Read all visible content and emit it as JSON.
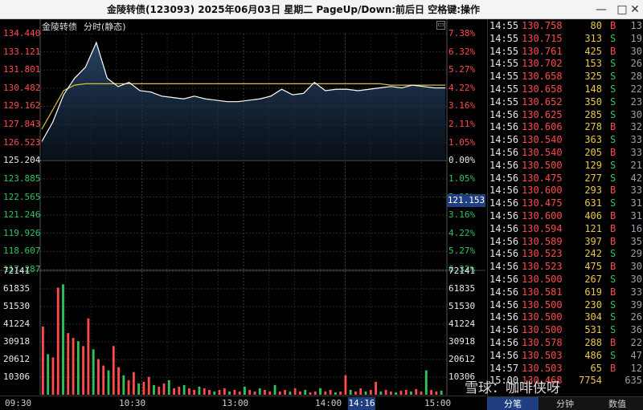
{
  "window": {
    "title": "金陵转债(123093) 2025年06月03日 星期二 PageUp/Down:前后日 空格键:操作",
    "buttons": [
      "minimize-icon",
      "close-icon"
    ]
  },
  "chart": {
    "name": "金陵转债",
    "mode": "分时(静态)",
    "checkbox": "▭",
    "prices_up": [
      "134.440",
      "133.121",
      "131.801",
      "130.482",
      "129.162",
      "127.843",
      "126.523"
    ],
    "price_base": "125.204",
    "prices_down": [
      "123.885",
      "122.565",
      "121.246",
      "119.926",
      "118.607",
      "117.287"
    ],
    "pct_up": [
      "7.38%",
      "6.32%",
      "5.27%",
      "4.22%",
      "3.16%",
      "2.11%",
      "1.05%"
    ],
    "pct_base": "0.00%",
    "pct_down": [
      "1.05%",
      "2.11%",
      "3.16%",
      "4.22%",
      "5.27%",
      "6.32%"
    ],
    "volume_labels": [
      "72141",
      "61835",
      "51530",
      "41224",
      "30918",
      "20612",
      "10306"
    ],
    "x_labels": [
      "09:30",
      "10:30",
      "13:00",
      "14:00",
      "15:00"
    ],
    "cursor_time": "14:16",
    "cursor_price": "121.153",
    "colors": {
      "up": "#ff4b4b",
      "down": "#2ec45c",
      "price_line": "#ffffff",
      "avg_line": "#d8c040",
      "cursor_bg": "#1f3f80"
    }
  },
  "chart_data": {
    "type": "line",
    "x": [
      "09:30",
      "10:30",
      "13:00",
      "14:00",
      "15:00"
    ],
    "ylim": [
      117.287,
      134.44
    ],
    "base_price": 125.204,
    "series": [
      {
        "name": "price",
        "values": [
          126.6,
          128.0,
          130.0,
          131.2,
          132.0,
          133.8,
          131.2,
          130.6,
          130.9,
          130.3,
          130.2,
          129.9,
          129.8,
          129.7,
          129.9,
          129.7,
          129.6,
          129.5,
          129.5,
          129.6,
          129.7,
          129.9,
          130.4,
          130.0,
          130.1,
          130.9,
          130.3,
          130.4,
          130.4,
          130.3,
          130.4,
          130.5,
          130.6,
          130.5,
          130.7,
          130.6,
          130.5,
          130.5
        ]
      },
      {
        "name": "avg",
        "values": [
          127.5,
          128.9,
          130.3,
          130.7,
          130.8,
          130.8,
          130.8,
          130.8,
          130.8,
          130.8,
          130.8,
          130.8,
          130.8,
          130.8,
          130.8,
          130.8,
          130.8,
          130.8,
          130.8,
          130.8,
          130.8,
          130.8,
          130.8,
          130.8,
          130.8,
          130.8,
          130.8,
          130.8,
          130.8,
          130.8,
          130.8,
          130.8,
          130.7,
          130.7,
          130.7,
          130.7,
          130.7,
          130.7
        ]
      }
    ],
    "volume_ylim": [
      0,
      72141
    ],
    "volume": [
      42000,
      25000,
      23000,
      66000,
      68000,
      38000,
      35000,
      33000,
      30000,
      47000,
      28000,
      22000,
      18000,
      15000,
      30000,
      17000,
      12000,
      9000,
      14000,
      7000,
      8000,
      11000,
      6000,
      5000,
      7000,
      9000,
      4000,
      5000,
      6000,
      4000,
      3000,
      5000,
      4000,
      3000,
      2000,
      3000,
      4000,
      2000,
      3000,
      2000,
      5000,
      3000,
      2000,
      4000,
      3000,
      2000,
      6000,
      2000,
      3000,
      2000,
      4000,
      2000,
      3000,
      1500,
      2000,
      4000,
      2000,
      3000,
      1500,
      2000,
      12000,
      3000,
      2000,
      4000,
      2000,
      3000,
      8000,
      2000,
      3000,
      2000,
      1500,
      2500,
      3000,
      2000,
      3500,
      2000,
      15000,
      3000,
      2000,
      2500
    ]
  },
  "trades": [
    {
      "time": "14:55",
      "price": "130.758",
      "vol": "80",
      "side": "B",
      "count": "13"
    },
    {
      "time": "14:55",
      "price": "130.715",
      "vol": "313",
      "side": "S",
      "count": "19"
    },
    {
      "time": "14:55",
      "price": "130.761",
      "vol": "425",
      "side": "B",
      "count": "30"
    },
    {
      "time": "14:55",
      "price": "130.702",
      "vol": "153",
      "side": "S",
      "count": "26"
    },
    {
      "time": "14:55",
      "price": "130.658",
      "vol": "325",
      "side": "S",
      "count": "28"
    },
    {
      "time": "14:55",
      "price": "130.658",
      "vol": "148",
      "side": "S",
      "count": "22"
    },
    {
      "time": "14:55",
      "price": "130.652",
      "vol": "350",
      "side": "S",
      "count": "23"
    },
    {
      "time": "14:56",
      "price": "130.625",
      "vol": "285",
      "side": "S",
      "count": "30"
    },
    {
      "time": "14:56",
      "price": "130.606",
      "vol": "278",
      "side": "B",
      "count": "32"
    },
    {
      "time": "14:56",
      "price": "130.540",
      "vol": "363",
      "side": "S",
      "count": "33"
    },
    {
      "time": "14:56",
      "price": "130.540",
      "vol": "205",
      "side": "B",
      "count": "33"
    },
    {
      "time": "14:56",
      "price": "130.500",
      "vol": "129",
      "side": "S",
      "count": "21"
    },
    {
      "time": "14:56",
      "price": "130.475",
      "vol": "277",
      "side": "S",
      "count": "42"
    },
    {
      "time": "14:56",
      "price": "130.600",
      "vol": "293",
      "side": "B",
      "count": "33"
    },
    {
      "time": "14:56",
      "price": "130.475",
      "vol": "631",
      "side": "S",
      "count": "31"
    },
    {
      "time": "14:56",
      "price": "130.600",
      "vol": "406",
      "side": "B",
      "count": "31"
    },
    {
      "time": "14:56",
      "price": "130.594",
      "vol": "121",
      "side": "B",
      "count": "16"
    },
    {
      "time": "14:56",
      "price": "130.589",
      "vol": "397",
      "side": "B",
      "count": "35"
    },
    {
      "time": "14:56",
      "price": "130.523",
      "vol": "242",
      "side": "S",
      "count": "29"
    },
    {
      "time": "14:56",
      "price": "130.523",
      "vol": "475",
      "side": "B",
      "count": "30"
    },
    {
      "time": "14:56",
      "price": "130.500",
      "vol": "267",
      "side": "S",
      "count": "30"
    },
    {
      "time": "14:56",
      "price": "130.581",
      "vol": "619",
      "side": "B",
      "count": "33"
    },
    {
      "time": "14:56",
      "price": "130.500",
      "vol": "230",
      "side": "S",
      "count": "39"
    },
    {
      "time": "14:56",
      "price": "130.500",
      "vol": "304",
      "side": "S",
      "count": "26"
    },
    {
      "time": "14:56",
      "price": "130.500",
      "vol": "531",
      "side": "S",
      "count": "36"
    },
    {
      "time": "14:56",
      "price": "130.578",
      "vol": "288",
      "side": "B",
      "count": "22"
    },
    {
      "time": "14:56",
      "price": "130.503",
      "vol": "486",
      "side": "S",
      "count": "47"
    },
    {
      "time": "14:57",
      "price": "130.503",
      "vol": "65",
      "side": "B",
      "count": "12"
    },
    {
      "time": "15:00",
      "price": "130.468",
      "vol": "7754",
      "side": "",
      "count": "635"
    }
  ],
  "tabs": [
    "分笔",
    "分钟",
    "数值"
  ],
  "watermark": "雪球：咖啡侠呀"
}
